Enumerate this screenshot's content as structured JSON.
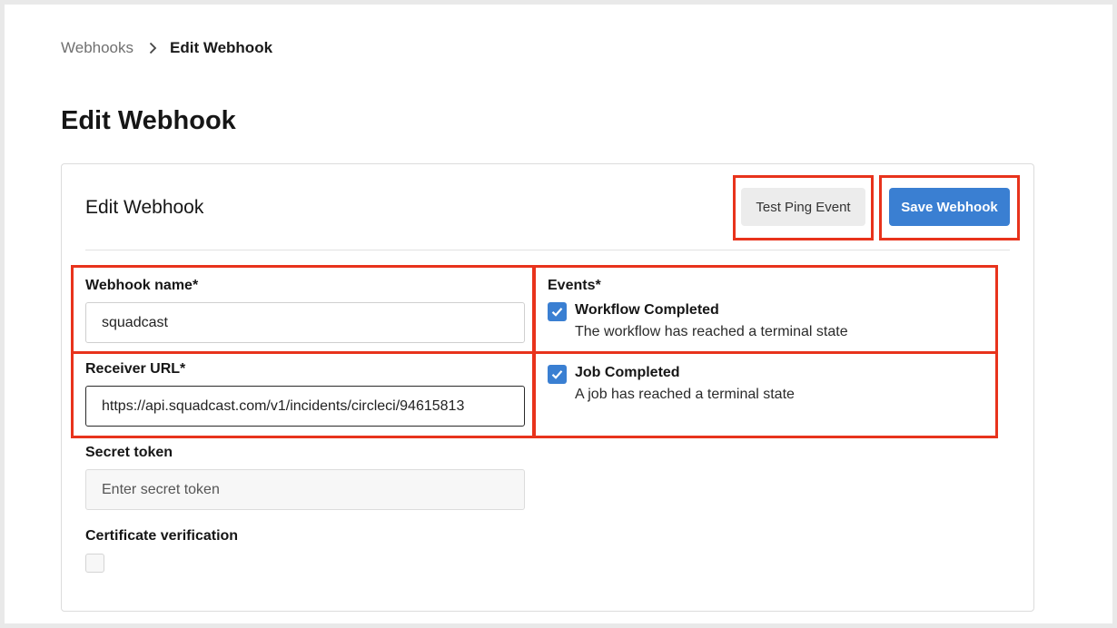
{
  "breadcrumb": {
    "parent": "Webhooks",
    "current": "Edit Webhook"
  },
  "page_title": "Edit Webhook",
  "card": {
    "title": "Edit Webhook",
    "test_button": "Test Ping Event",
    "save_button": "Save Webhook"
  },
  "form": {
    "name_label": "Webhook name*",
    "name_value": "squadcast",
    "url_label": "Receiver URL*",
    "url_value": "https://api.squadcast.com/v1/incidents/circleci/94615813",
    "secret_label": "Secret token",
    "secret_placeholder": "Enter secret token",
    "cert_label": "Certificate verification",
    "cert_checked": false
  },
  "events": {
    "label": "Events*",
    "items": [
      {
        "title": "Workflow Completed",
        "description": "The workflow has reached a terminal state",
        "checked": true
      },
      {
        "title": "Job Completed",
        "description": "A job has reached a terminal state",
        "checked": true
      }
    ]
  },
  "colors": {
    "accent": "#3a7fd2",
    "highlight": "#e8331c"
  },
  "icons": {
    "breadcrumb_separator": "chevron-right-icon",
    "checkbox_checked": "checkmark-icon"
  }
}
